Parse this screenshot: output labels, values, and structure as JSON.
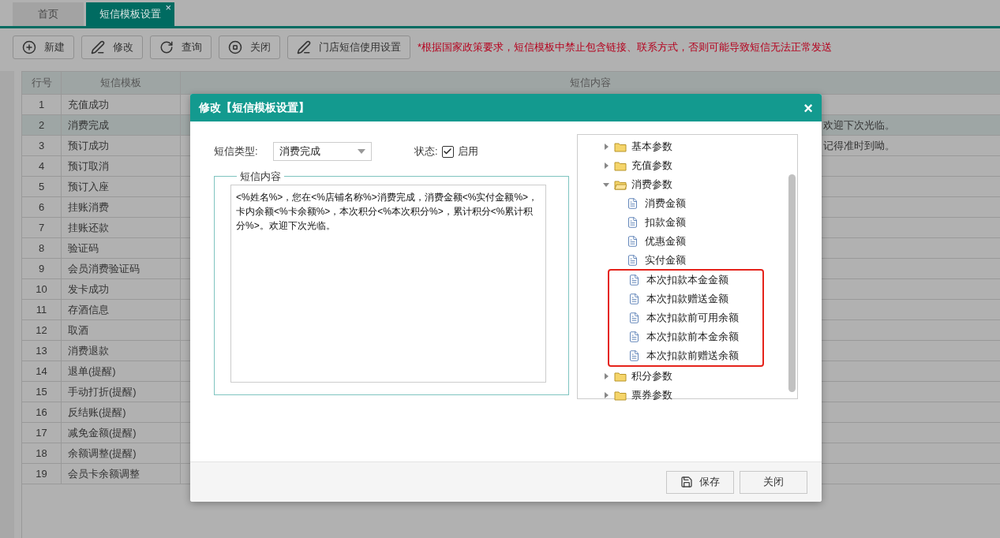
{
  "tabs": [
    {
      "label": "首页",
      "selected": false
    },
    {
      "label": "短信模板设置",
      "selected": true,
      "close": "×"
    }
  ],
  "toolbar": {
    "buttons": [
      {
        "label": "新建",
        "kind": "new"
      },
      {
        "label": "修改",
        "kind": "edit"
      },
      {
        "label": "查询",
        "kind": "query"
      },
      {
        "label": "关闭",
        "kind": "close"
      },
      {
        "label": "门店短信使用设置",
        "kind": "edit"
      }
    ],
    "notice": "*根据国家政策要求，短信模板中禁止包含链接、联系方式，否则可能导致短信无法正常发送"
  },
  "table": {
    "columns": [
      "行号",
      "短信模板",
      "短信内容"
    ],
    "rows": [
      {
        "no": "1",
        "template": "充值成功",
        "selected": false
      },
      {
        "no": "2",
        "template": "消费完成",
        "content": "欢迎下次光临。",
        "selected": true
      },
      {
        "no": "3",
        "template": "预订成功",
        "content": "记得准时到呦。",
        "selected": false
      },
      {
        "no": "4",
        "template": "预订取消",
        "selected": false
      },
      {
        "no": "5",
        "template": "预订入座",
        "selected": false
      },
      {
        "no": "6",
        "template": "挂账消费",
        "selected": false
      },
      {
        "no": "7",
        "template": "挂账还款",
        "selected": false
      },
      {
        "no": "8",
        "template": "验证码",
        "selected": false
      },
      {
        "no": "9",
        "template": "会员消费验证码",
        "selected": false
      },
      {
        "no": "10",
        "template": "发卡成功",
        "selected": false
      },
      {
        "no": "11",
        "template": "存酒信息",
        "selected": false
      },
      {
        "no": "12",
        "template": "取酒",
        "selected": false
      },
      {
        "no": "13",
        "template": "消费退款",
        "selected": false
      },
      {
        "no": "14",
        "template": "退单(提醒)",
        "selected": false
      },
      {
        "no": "15",
        "template": "手动打折(提醒)",
        "selected": false
      },
      {
        "no": "16",
        "template": "反结账(提醒)",
        "selected": false
      },
      {
        "no": "17",
        "template": "减免金额(提醒)",
        "selected": false
      },
      {
        "no": "18",
        "template": "余额调整(提醒)",
        "selected": false
      },
      {
        "no": "19",
        "template": "会员卡余额调整",
        "selected": false
      }
    ]
  },
  "dialog": {
    "title": "修改【短信模板设置】",
    "close": "×",
    "type_label": "短信类型:",
    "type_value": "消费完成",
    "status_label": "状态:",
    "status_checked": true,
    "status_text": "启用",
    "content_legend": "短信内容",
    "content": "<%姓名%>，您在<%店铺名称%>消费完成，消费金额<%实付金额%>，卡内余额<%卡余额%>，本次积分<%本次积分%>，累计积分<%累计积分%>。欢迎下次光临。",
    "tree": [
      {
        "label": "基本参数",
        "expanded": false
      },
      {
        "label": "充值参数",
        "expanded": false
      },
      {
        "label": "消费参数",
        "expanded": true,
        "children": [
          {
            "label": "消费金额",
            "highlighted": false
          },
          {
            "label": "扣款金额",
            "highlighted": false
          },
          {
            "label": "优惠金额",
            "highlighted": false
          },
          {
            "label": "实付金额",
            "highlighted": false
          },
          {
            "label": "本次扣款本金金额",
            "highlighted": true
          },
          {
            "label": "本次扣款赠送金额",
            "highlighted": true
          },
          {
            "label": "本次扣款前可用余额",
            "highlighted": true
          },
          {
            "label": "本次扣款前本金余额",
            "highlighted": true
          },
          {
            "label": "本次扣款前赠送余额",
            "highlighted": true
          }
        ]
      },
      {
        "label": "积分参数",
        "expanded": false
      },
      {
        "label": "票券参数",
        "expanded": false
      }
    ],
    "buttons": [
      {
        "label": "保存",
        "kind": "save"
      },
      {
        "label": "关闭",
        "kind": "plain"
      }
    ]
  }
}
